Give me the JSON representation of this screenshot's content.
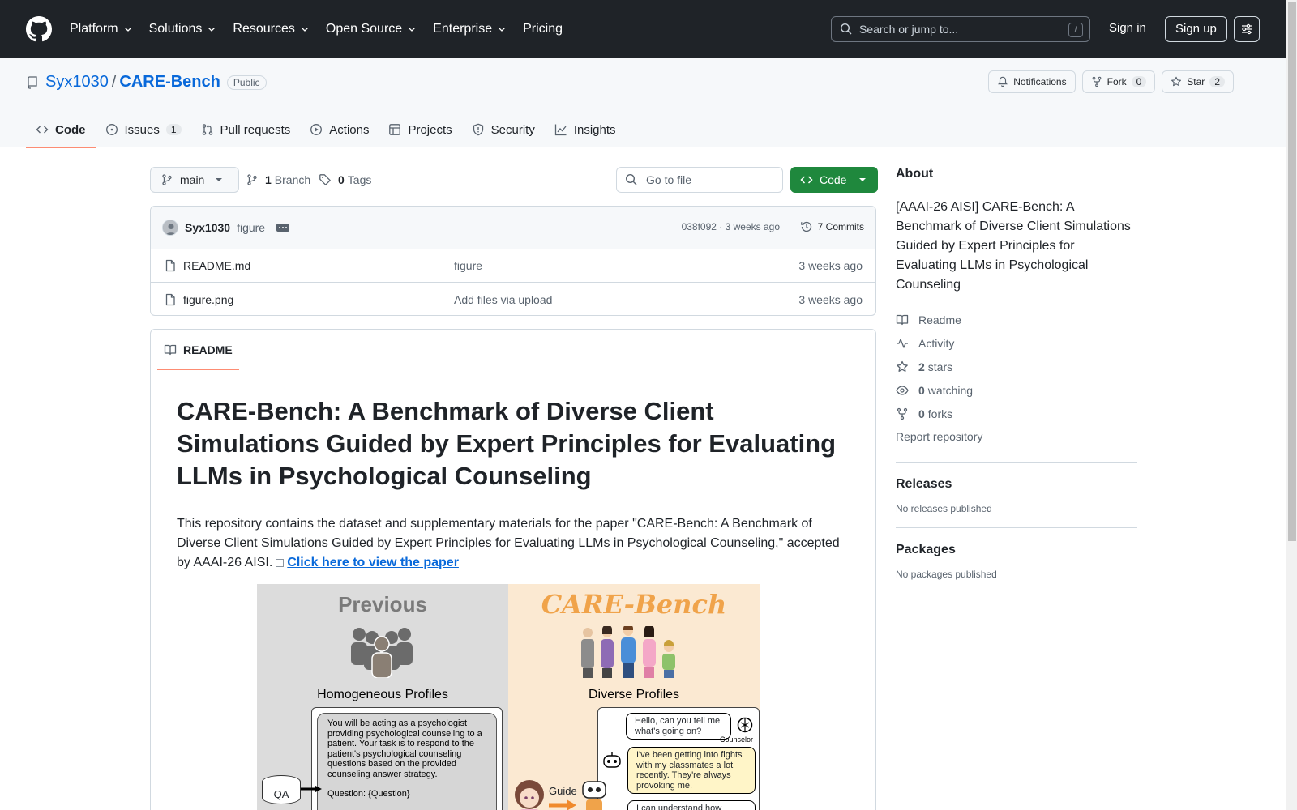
{
  "header": {
    "nav": [
      "Platform",
      "Solutions",
      "Resources",
      "Open Source",
      "Enterprise",
      "Pricing"
    ],
    "nav_has_dropdown": [
      true,
      true,
      true,
      true,
      true,
      false
    ],
    "search_placeholder": "Search or jump to...",
    "search_shortcut": "/",
    "sign_in": "Sign in",
    "sign_up": "Sign up"
  },
  "repo": {
    "owner": "Syx1030",
    "separator": "/",
    "name": "CARE-Bench",
    "visibility": "Public",
    "notifications": "Notifications",
    "fork_label": "Fork",
    "fork_count": "0",
    "star_label": "Star",
    "star_count": "2"
  },
  "tabs": [
    {
      "label": "Code",
      "icon": "code-icon",
      "active": true
    },
    {
      "label": "Issues",
      "icon": "issue-icon",
      "count": "1"
    },
    {
      "label": "Pull requests",
      "icon": "pull-request-icon"
    },
    {
      "label": "Actions",
      "icon": "play-icon"
    },
    {
      "label": "Projects",
      "icon": "table-icon"
    },
    {
      "label": "Security",
      "icon": "shield-icon"
    },
    {
      "label": "Insights",
      "icon": "graph-icon"
    }
  ],
  "file_bar": {
    "branch": "main",
    "branch_count": "1",
    "branch_label": "Branch",
    "tag_count": "0",
    "tag_label": "Tags",
    "goto_placeholder": "Go to file",
    "code_button": "Code"
  },
  "commit": {
    "author": "Syx1030",
    "message": "figure",
    "hash_time": "038f092 · 3 weeks ago",
    "commits": "7 Commits"
  },
  "files": [
    {
      "name": "README.md",
      "message": "figure",
      "time": "3 weeks ago"
    },
    {
      "name": "figure.png",
      "message": "Add files via upload",
      "time": "3 weeks ago"
    }
  ],
  "readme": {
    "tab": "README",
    "title": "CARE-Bench: A Benchmark of Diverse Client Simulations Guided by Expert Principles for Evaluating LLMs in Psychological Counseling",
    "intro": "This repository contains the dataset and supplementary materials for the paper \"CARE-Bench: A Benchmark of Diverse Client Simulations Guided by Expert Principles for Evaluating LLMs in Psychological Counseling,\" accepted by AAAI-26 AISI.",
    "paper_link": "Click here to view the paper",
    "figure": {
      "left_title": "Previous",
      "right_title": "CARE-Bench",
      "left_sub": "Homogeneous Profiles",
      "right_sub": "Diverse Profiles",
      "prompt_text": "You will be acting as a psychologist providing psychological counseling to a patient. Your task is to respond to the patient's psychological counseling questions based on the provided counseling answer strategy.",
      "prompt_question": "Question: {Question}",
      "qa_label": "QA",
      "bubble1": "Hello, can you tell me what's going on?",
      "counselor_label": "Counselor",
      "bubble2": "I've been getting into fights with my classmates a lot recently. They're always provoking me.",
      "bubble3": "I can understand how",
      "guide_label": "Guide"
    }
  },
  "about": {
    "heading": "About",
    "description": "[AAAI-26 AISI] CARE-Bench: A Benchmark of Diverse Client Simulations Guided by Expert Principles for Evaluating LLMs in Psychological Counseling",
    "links": [
      {
        "icon": "book-icon",
        "label": "Readme"
      },
      {
        "icon": "pulse-icon",
        "label": "Activity"
      },
      {
        "icon": "star-icon",
        "bold": "2",
        "label": "stars"
      },
      {
        "icon": "eye-icon",
        "bold": "0",
        "label": "watching"
      },
      {
        "icon": "fork-icon",
        "bold": "0",
        "label": "forks"
      }
    ],
    "report": "Report repository",
    "releases_heading": "Releases",
    "releases_text": "No releases published",
    "packages_heading": "Packages",
    "packages_text": "No packages published"
  }
}
